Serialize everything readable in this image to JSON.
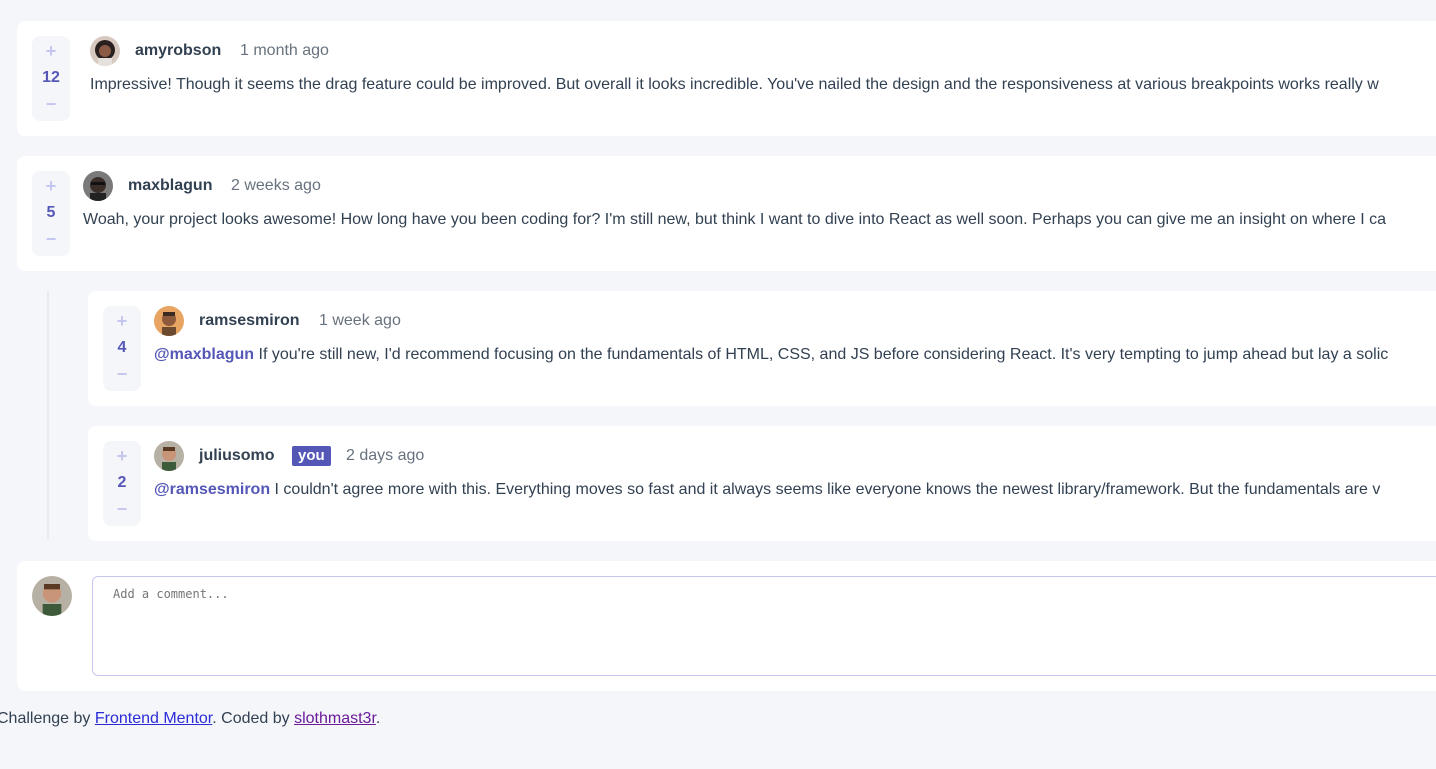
{
  "comments": [
    {
      "score": "12",
      "username": "amyrobson",
      "time": "1 month ago",
      "mention": "",
      "text": "Impressive! Though it seems the drag feature could be improved. But overall it looks incredible. You've nailed the design and the responsiveness at various breakpoints works really w"
    },
    {
      "score": "5",
      "username": "maxblagun",
      "time": "2 weeks ago",
      "mention": "",
      "text": "Woah, your project looks awesome! How long have you been coding for? I'm still new, but think I want to dive into React as well soon. Perhaps you can give me an insight on where I ca"
    }
  ],
  "replies": [
    {
      "score": "4",
      "username": "ramsesmiron",
      "time": "1 week ago",
      "mention": "@maxblagun",
      "text": " If you're still new, I'd recommend focusing on the fundamentals of HTML, CSS, and JS before considering React. It's very tempting to jump ahead but lay a solic"
    },
    {
      "score": "2",
      "username": "juliusomo",
      "you_badge": "you",
      "time": "2 days ago",
      "mention": "@ramsesmiron",
      "text": " I couldn't agree more with this. Everything moves so fast and it always seems like everyone knows the newest library/framework. But the fundamentals are v"
    }
  ],
  "vote": {
    "plus": "+",
    "minus": "−"
  },
  "new_comment": {
    "placeholder": "Add a comment..."
  },
  "footer": {
    "prefix": "Challenge by ",
    "link1": "Frontend Mentor",
    "middle": ". Coded by ",
    "link2": "slothmast3r",
    "suffix": "."
  },
  "colors": {
    "accent": "#5457b6",
    "light_accent": "#c5c6ef",
    "background": "#f5f6fa",
    "text": "#324152",
    "muted": "#67727e"
  }
}
